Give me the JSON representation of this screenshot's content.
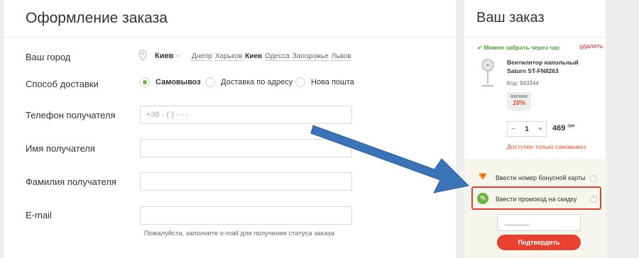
{
  "checkout": {
    "title": "Оформление заказа",
    "city": {
      "label": "Ваш город",
      "selected": "Киев",
      "quick_cities": [
        "Днепр",
        "Харьков",
        "Киев",
        "Одесса",
        "Запорожье",
        "Львов"
      ]
    },
    "delivery": {
      "label": "Способ доставки",
      "options": [
        "Самовывоз",
        "Доставка по адресу",
        "Нова пошта"
      ],
      "selected": "Самовывоз"
    },
    "phone": {
      "label": "Телефон получателя",
      "placeholder": "+38 - (    ) -      -      -"
    },
    "first_name": {
      "label": "Имя получателя",
      "value": ""
    },
    "last_name": {
      "label": "Фамилия получателя",
      "value": ""
    },
    "email": {
      "label": "E-mail",
      "value": "",
      "hint": "Пожалуйста, заполните e-mail для получения статуса заказа"
    }
  },
  "order": {
    "title": "Ваш заказ",
    "availability": "✔ Можно забрать через час",
    "remove_label": "удалить",
    "product": {
      "name": "Вентилятор напольный Saturn ST-FN8263",
      "sku": "Код: 943344",
      "cashback_top": "ВЕРНЕМ",
      "cashback_value": "10%",
      "quantity": "1",
      "qty_minus": "−",
      "qty_plus": "+",
      "price": "469",
      "currency": "грн",
      "pickup_note": "Доступен только самовывоз"
    },
    "bonus_card_label": "Ввести номер бонусной карты",
    "promo_label": "Ввести промокод на скидку",
    "promo_icon_text": "%",
    "confirm_label": "Подтвердить"
  },
  "colors": {
    "accent": "#e8412f",
    "green": "#6cb43f",
    "arrow": "#3a73b7"
  }
}
